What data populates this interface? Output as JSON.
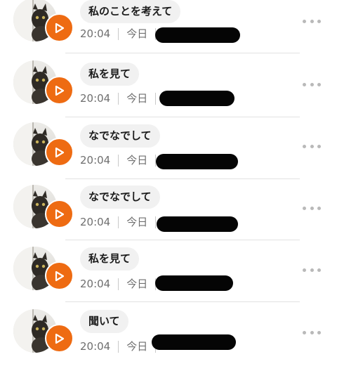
{
  "items": [
    {
      "title": "私のことを考えて",
      "time": "20:04",
      "day": "今日"
    },
    {
      "title": "私を見て",
      "time": "20:04",
      "day": "今日"
    },
    {
      "title": "なでなでして",
      "time": "20:04",
      "day": "今日"
    },
    {
      "title": "なでなでして",
      "time": "20:04",
      "day": "今日"
    },
    {
      "title": "私を見て",
      "time": "20:04",
      "day": "今日"
    },
    {
      "title": "聞いて",
      "time": "20:04",
      "day": "今日"
    }
  ],
  "icons": {
    "thumbnail": "cat-photo-icon",
    "play": "play-icon",
    "more": "more-dots-icon"
  },
  "colors": {
    "accent": "#ee6b12",
    "chip_bg": "#f1f1f1",
    "meta_text": "#6f6f6f",
    "redaction": "#050505"
  }
}
